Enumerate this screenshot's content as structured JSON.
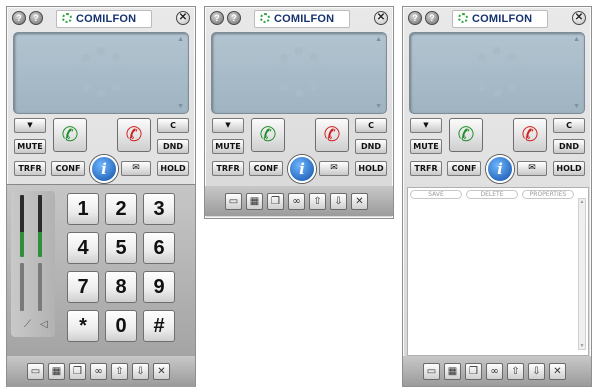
{
  "brand": {
    "name": "COMILFON"
  },
  "controls": {
    "dropdown": "▼",
    "mute": "MUTE",
    "transfer": "TRFR",
    "conference": "CONF",
    "clear": "C",
    "dnd": "DND",
    "hold": "HOLD",
    "info": "i"
  },
  "keypad": [
    "1",
    "2",
    "3",
    "4",
    "5",
    "6",
    "7",
    "8",
    "9",
    "*",
    "0",
    "#"
  ],
  "contacts_panel": {
    "save": "SAVE",
    "delete": "DELETE",
    "properties": "PROPERTIES"
  },
  "icons": {
    "titlebar": [
      "help-icon",
      "help-icon",
      "close-icon"
    ],
    "call": [
      "answer-call-icon",
      "hangup-call-icon"
    ],
    "toolbar": [
      "phone-icon",
      "keypad-icon",
      "book-icon",
      "voicemail-icon",
      "arrow-up-icon",
      "arrow-down-icon",
      "close-icon"
    ]
  },
  "colors": {
    "answer": "#1f8e2a",
    "hangup": "#cf2020",
    "brand": "#16326f",
    "screen": "#a9bccb"
  }
}
